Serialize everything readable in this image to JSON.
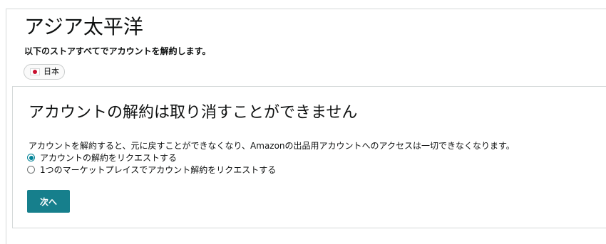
{
  "region": {
    "title": "アジア太平洋",
    "subtitle": "以下のストアすべてでアカウントを解約します。",
    "stores": [
      {
        "label": "日本",
        "flag_icon": "japan-flag-icon"
      }
    ]
  },
  "panel": {
    "title": "アカウントの解約は取り消すことができません",
    "warning": "アカウントを解約すると、元に戻すことができなくなり、Amazonの出品用アカウントへのアクセスは一切できなくなります。",
    "options": [
      {
        "label": "アカウントの解約をリクエストする",
        "checked": true
      },
      {
        "label": "1つのマーケットプレイスでアカウント解約をリクエストする",
        "checked": false
      }
    ],
    "next_label": "次へ"
  },
  "colors": {
    "accent": "#008296",
    "button": "#167f8c",
    "border": "#d5d9d9",
    "flag_red": "#c8102e"
  }
}
